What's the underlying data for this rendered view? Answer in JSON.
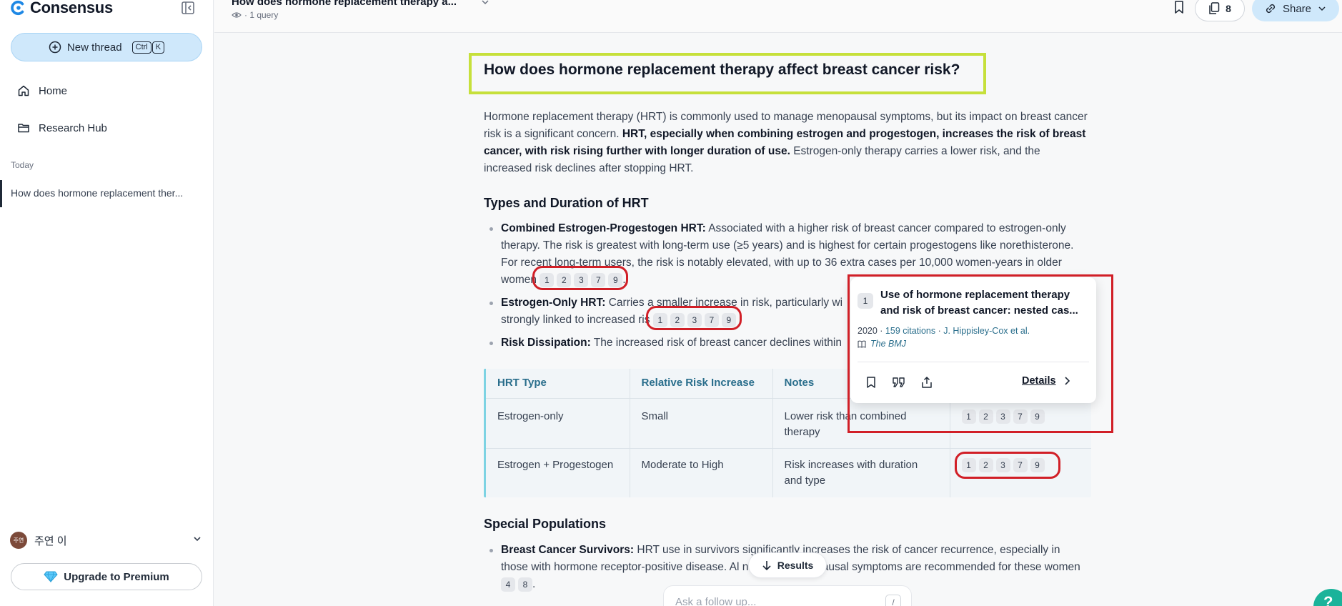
{
  "sidebar": {
    "brand": "Consensus",
    "new_thread": {
      "label": "New thread",
      "keys": [
        "Ctrl",
        "K"
      ]
    },
    "nav": [
      {
        "label": "Home",
        "icon": "home-icon"
      },
      {
        "label": "Research Hub",
        "icon": "folder-icon"
      }
    ],
    "section_label": "Today",
    "threads": [
      "How does hormone replacement ther..."
    ],
    "user": {
      "avatar": "주연",
      "name": "주연 이"
    },
    "upgrade_label": "Upgrade to Premium"
  },
  "header": {
    "thread_title": "How does hormone replacement therapy a...",
    "query_count": "· 1 query",
    "saved_count": "8",
    "share_label": "Share"
  },
  "main": {
    "question": "How does hormone replacement therapy affect breast cancer risk?",
    "intro": {
      "part1": "Hormone replacement therapy (HRT) is commonly used to manage menopausal symptoms, but its impact on breast cancer risk is a significant concern. ",
      "bold": "HRT, especially when combining estrogen and progestogen, increases the risk of breast cancer, with risk rising further with longer duration of use.",
      "part2": " Estrogen-only therapy carries a lower risk, and the increased risk declines after stopping HRT."
    },
    "section1": {
      "heading": "Types and Duration of HRT",
      "items": [
        {
          "title": "Combined Estrogen-Progestogen HRT:",
          "text": " Associated with a higher risk of breast cancer compared to estrogen-only therapy. The risk is greatest with long-term use (≥5 years) and is highest for certain progestogens like norethisterone. For recent long-term users, the risk is notably elevated, with up to 36 extra cases per 10,000 women-years in older women",
          "refs": [
            "1",
            "2",
            "3",
            "7",
            "9"
          ]
        },
        {
          "title": "Estrogen-Only HRT:",
          "text": " Carries a smaller increase in risk, particularly wi",
          "text2": "strongly linked to increased ris",
          "refs": [
            "1",
            "2",
            "3",
            "7",
            "9"
          ]
        },
        {
          "title": "Risk Dissipation:",
          "text": " The increased risk of breast cancer declines within"
        }
      ]
    },
    "table": {
      "headers": [
        "HRT Type",
        "Relative Risk Increase",
        "Notes",
        ""
      ],
      "rows": [
        {
          "type": "Estrogen-only",
          "risk": "Small",
          "notes": "Lower risk than combined therapy",
          "refs": [
            "1",
            "2",
            "3",
            "7",
            "9"
          ]
        },
        {
          "type": "Estrogen + Progestogen",
          "risk": "Moderate to High",
          "notes": "Risk increases with duration and type",
          "refs": [
            "1",
            "2",
            "3",
            "7",
            "9"
          ]
        }
      ]
    },
    "section2": {
      "heading": "Special Populations",
      "items": [
        {
          "title": "Breast Cancer Survivors:",
          "text": " HRT use in survivors significantly increases the risk of cancer recurrence, especially in those with hormone receptor-positive disease. Al",
          "text_cont": "nents for menopausal symptoms are recommended for these women",
          "refs": [
            "4",
            "8"
          ]
        }
      ]
    }
  },
  "popup": {
    "num": "1",
    "title": "Use of hormone replacement therapy and risk of breast cancer: nested cas...",
    "year": "2020",
    "citations": "159 citations",
    "authors": "J. Hippisley-Cox et al.",
    "journal": "The BMJ",
    "details_label": "Details"
  },
  "floating": {
    "results_label": "Results",
    "followup_placeholder": "Ask a follow up...",
    "followup_shortcut": "/",
    "help": "?"
  },
  "colors": {
    "accent": "#cfe8fb",
    "highlight_box": "#c6e03b",
    "annotation": "#d11f27",
    "table_header": "#2a6e8c"
  }
}
